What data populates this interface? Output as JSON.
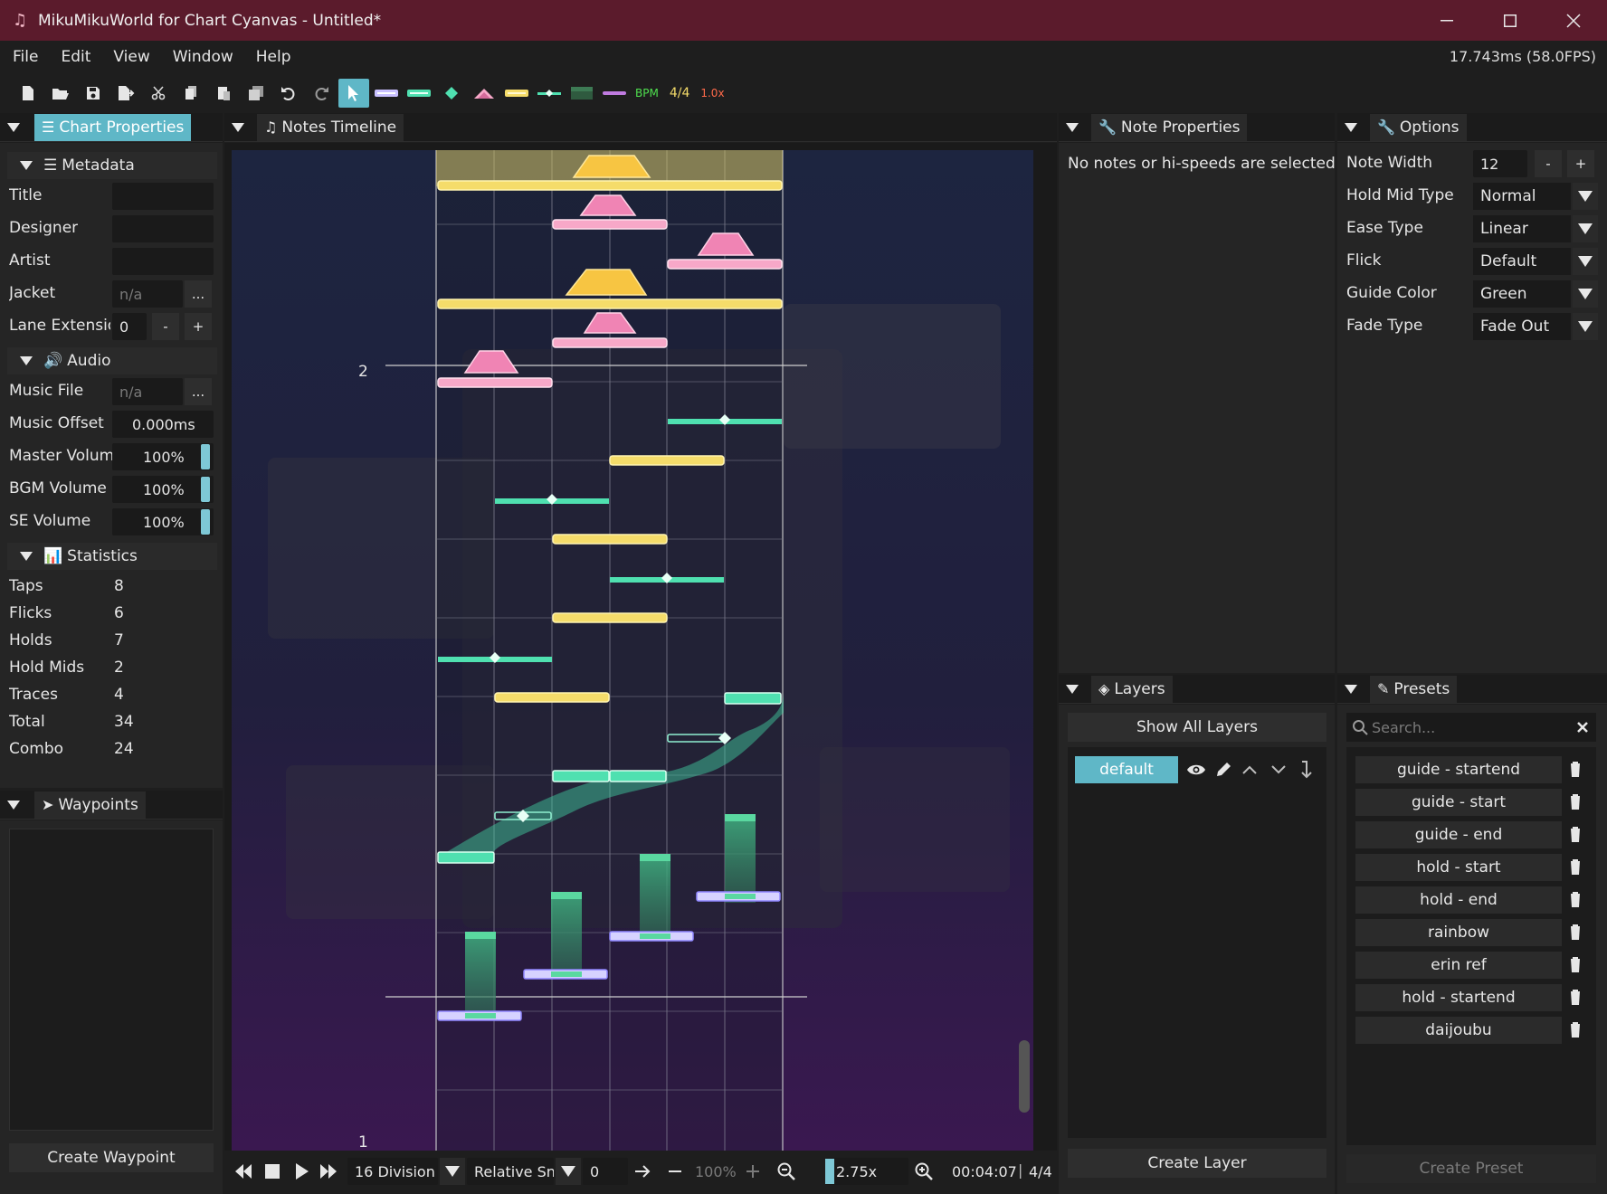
{
  "window": {
    "title": "MikuMikuWorld for Chart Cyanvas - Untitled*"
  },
  "menu": {
    "items": [
      "File",
      "Edit",
      "View",
      "Window",
      "Help"
    ],
    "perf": "17.743ms (58.0FPS)"
  },
  "toolbar": {
    "bpm_label": "BPM",
    "time_signature": "4/4",
    "speed": "1.0x"
  },
  "chart_properties": {
    "tab_label": "Chart Properties",
    "metadata_label": "Metadata",
    "fields": {
      "title_label": "Title",
      "title_value": "",
      "designer_label": "Designer",
      "designer_value": "",
      "artist_label": "Artist",
      "artist_value": "",
      "jacket_label": "Jacket",
      "jacket_placeholder": "n/a",
      "lane_ext_label": "Lane Extensior",
      "lane_ext_value": "0",
      "browse": "...",
      "minus": "-",
      "plus": "+"
    },
    "audio_label": "Audio",
    "audio": {
      "music_file_label": "Music File",
      "music_file_placeholder": "n/a",
      "offset_label": "Music Offset",
      "offset_value": "0.000ms",
      "master_label": "Master Volume",
      "master_value": "100%",
      "bgm_label": "BGM Volume",
      "bgm_value": "100%",
      "se_label": "SE Volume",
      "se_value": "100%"
    },
    "statistics_label": "Statistics",
    "statistics": [
      {
        "label": "Taps",
        "value": "8"
      },
      {
        "label": "Flicks",
        "value": "6"
      },
      {
        "label": "Holds",
        "value": "7"
      },
      {
        "label": "Hold Mids",
        "value": "2"
      },
      {
        "label": "Traces",
        "value": "4"
      },
      {
        "label": "Total",
        "value": "34"
      },
      {
        "label": "Combo",
        "value": "24"
      }
    ]
  },
  "waypoints": {
    "tab_label": "Waypoints",
    "create_button": "Create Waypoint"
  },
  "timeline": {
    "tab_label": "Notes Timeline",
    "measure_labels": [
      "2",
      "1"
    ],
    "division": "16 Division",
    "snap_mode": "Relative Sn",
    "snap_value": "0",
    "zoom_percent": "100%",
    "zoom_scale": "2.75x",
    "time": "00:04:07",
    "time_sig": "4/4"
  },
  "note_properties": {
    "tab_label": "Note Properties",
    "empty_message": "No notes or hi-speeds are selected"
  },
  "options": {
    "tab_label": "Options",
    "note_width_label": "Note Width",
    "note_width_value": "12",
    "minus": "-",
    "plus": "+",
    "hold_mid_label": "Hold Mid Type",
    "hold_mid_value": "Normal",
    "ease_label": "Ease Type",
    "ease_value": "Linear",
    "flick_label": "Flick",
    "flick_value": "Default",
    "guide_color_label": "Guide Color",
    "guide_color_value": "Green",
    "fade_label": "Fade Type",
    "fade_value": "Fade Out"
  },
  "layers": {
    "tab_label": "Layers",
    "show_all": "Show All Layers",
    "layer_name": "default",
    "create_button": "Create Layer"
  },
  "presets": {
    "tab_label": "Presets",
    "search_placeholder": "Search...",
    "items": [
      "guide - startend",
      "guide - start",
      "guide - end",
      "hold - start",
      "hold - end",
      "rainbow",
      "erin ref",
      "hold - startend",
      "daijoubu"
    ],
    "create_button": "Create Preset"
  },
  "colors": {
    "titlebar": "#5b1b2c",
    "accent": "#5fb7c7",
    "tap_pink": "#f7a8c8",
    "critical_yellow": "#f5dc6a",
    "hold_green": "#4fe0b0"
  }
}
